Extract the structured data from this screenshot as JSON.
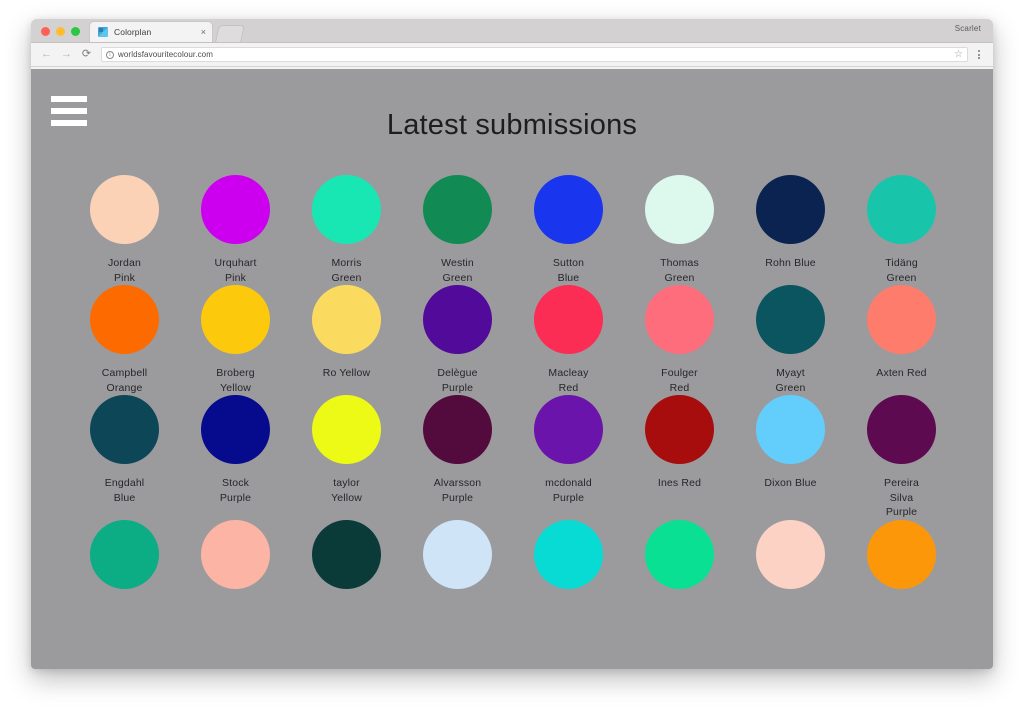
{
  "browser": {
    "tab_title": "Colorplan",
    "tab_close_label": "×",
    "url": "worldsfavouritecolour.com",
    "profile_name": "Scarlet",
    "back_label": "←",
    "forward_label": "→",
    "reload_label": "⟳",
    "info_label": "i",
    "star_label": "☆"
  },
  "page": {
    "title": "Latest submissions",
    "background_color": "#9b9b9e",
    "text_color": "#26262b",
    "menu_label": "menu"
  },
  "swatches": [
    {
      "name": "Jordan\nPink",
      "color": "#fbd2b6"
    },
    {
      "name": "Urquhart\nPink",
      "color": "#cc00ee"
    },
    {
      "name": "Morris\nGreen",
      "color": "#18e7b4"
    },
    {
      "name": "Westin\nGreen",
      "color": "#118a53"
    },
    {
      "name": "Sutton\nBlue",
      "color": "#1a35ee"
    },
    {
      "name": "Thomas\nGreen",
      "color": "#ddf8ec"
    },
    {
      "name": "Rohn Blue",
      "color": "#0b2350"
    },
    {
      "name": "Tidäng\nGreen",
      "color": "#18c5aa"
    },
    {
      "name": "Campbell\nOrange",
      "color": "#fd6a00"
    },
    {
      "name": "Broberg\nYellow",
      "color": "#fdc90d"
    },
    {
      "name": "Ro Yellow",
      "color": "#fbdb5f"
    },
    {
      "name": "Delègue\nPurple",
      "color": "#510a99"
    },
    {
      "name": "Macleay\nRed",
      "color": "#fb2d55"
    },
    {
      "name": "Foulger\nRed",
      "color": "#fd6d7c"
    },
    {
      "name": "Myayt\nGreen",
      "color": "#0b5560"
    },
    {
      "name": "Axten Red",
      "color": "#fd7c6b"
    },
    {
      "name": "Engdahl\nBlue",
      "color": "#0d4757"
    },
    {
      "name": "Stock\nPurple",
      "color": "#060a8c"
    },
    {
      "name": "taylor\nYellow",
      "color": "#ecfa15"
    },
    {
      "name": "Alvarsson\nPurple",
      "color": "#530a3c"
    },
    {
      "name": "mcdonald\nPurple",
      "color": "#6a14ab"
    },
    {
      "name": "Ines Red",
      "color": "#a80d0d"
    },
    {
      "name": "Dixon Blue",
      "color": "#63cdfc"
    },
    {
      "name": "Pereira\nSilva\nPurple",
      "color": "#5d0a50"
    },
    {
      "name": "",
      "color": "#0cac84"
    },
    {
      "name": "",
      "color": "#fcb4a5"
    },
    {
      "name": "",
      "color": "#0a3b39"
    },
    {
      "name": "",
      "color": "#cfe4f7"
    },
    {
      "name": "",
      "color": "#07dbd3"
    },
    {
      "name": "",
      "color": "#0ae094"
    },
    {
      "name": "",
      "color": "#fbd2c4"
    },
    {
      "name": "",
      "color": "#fc9709"
    }
  ]
}
